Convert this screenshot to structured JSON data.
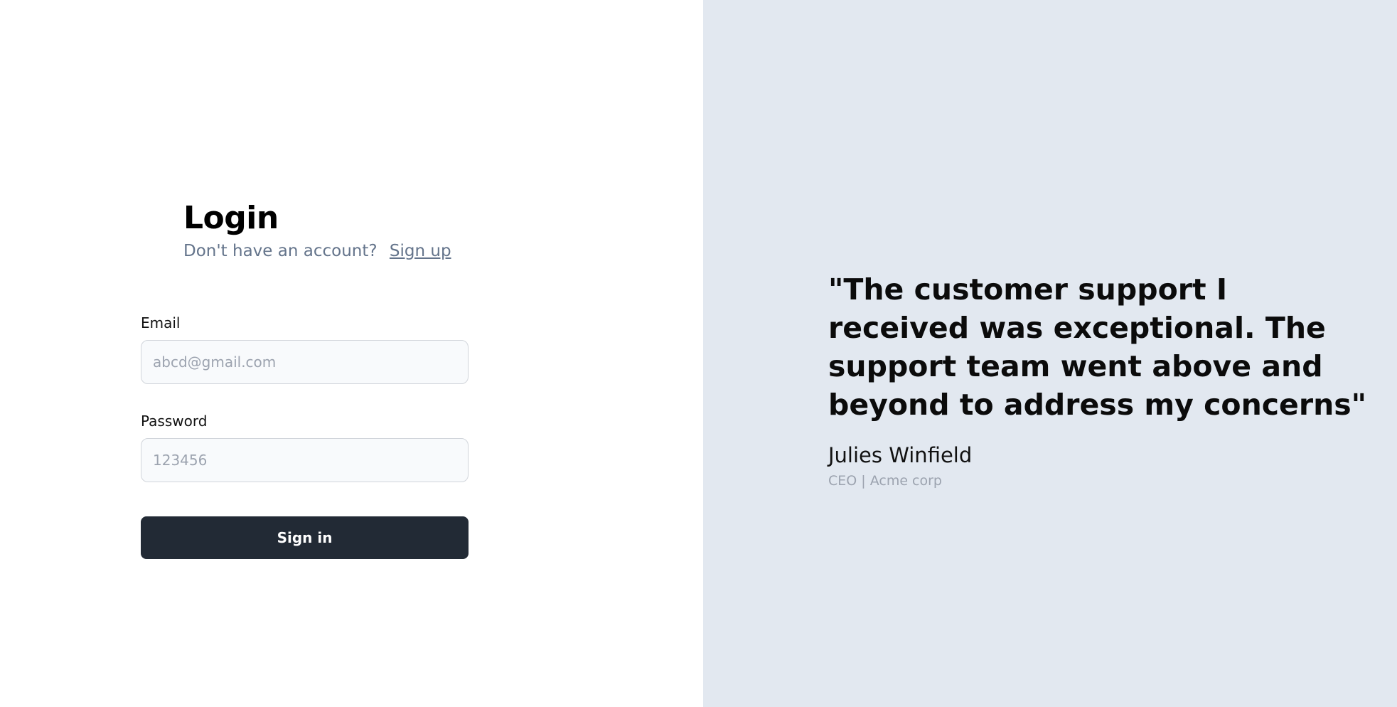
{
  "login": {
    "title": "Login",
    "signup_prompt": "Don't have an account?",
    "signup_link": "Sign up"
  },
  "form": {
    "email_label": "Email",
    "email_placeholder": "abcd@gmail.com",
    "password_label": "Password",
    "password_placeholder": "123456",
    "signin_label": "Sign in"
  },
  "testimonial": {
    "quote": "\"The customer support I received was exceptional. The support team went above and beyond to address my concerns\"",
    "author_name": "Julies Winfield",
    "author_role": "CEO | Acme corp"
  },
  "colors": {
    "left_background": "#ffffff",
    "right_background": "#e2e8f0",
    "button_background": "#222a35",
    "muted_text": "#64748b"
  }
}
